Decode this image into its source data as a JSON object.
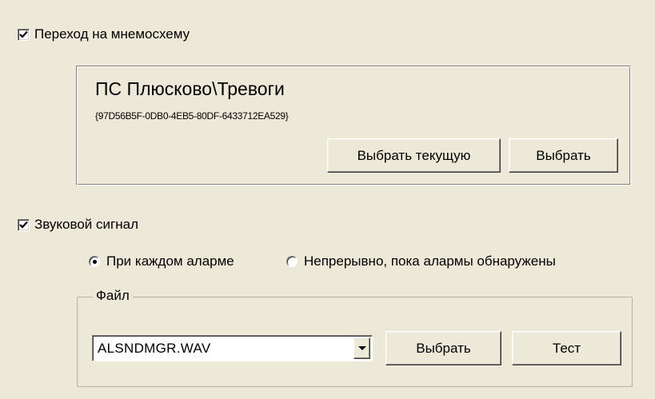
{
  "mnemo": {
    "checked": true,
    "label": "Переход на мнемосхему",
    "path": "ПС Плюсково\\Тревоги",
    "guid": "{97D56B5F-0DB0-4EB5-80DF-6433712EA529}",
    "select_current_label": "Выбрать текущую",
    "select_label": "Выбрать"
  },
  "sound": {
    "checked": true,
    "label": "Звуковой сигнал",
    "mode_options": [
      {
        "label": "При каждом аларме",
        "selected": true
      },
      {
        "label": "Непрерывно, пока алармы обнаружены",
        "selected": false
      }
    ],
    "file_group_label": "Файл",
    "file_value": "ALSNDMGR.WAV",
    "select_label": "Выбрать",
    "test_label": "Тест"
  }
}
